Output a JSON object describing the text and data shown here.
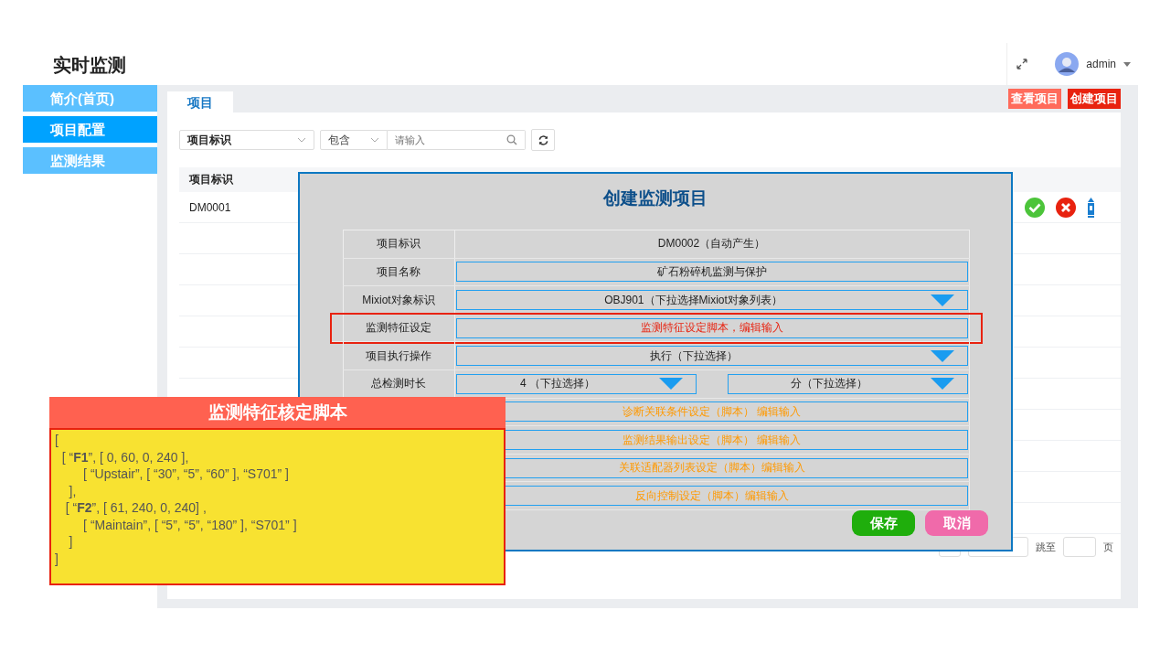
{
  "header": {
    "title": "实时监测",
    "user": "admin"
  },
  "sidebar": {
    "items": [
      {
        "label": "简介(首页)",
        "selected": false
      },
      {
        "label": "项目配置",
        "selected": true
      },
      {
        "label": "监测结果",
        "selected": false
      }
    ]
  },
  "tabs": [
    {
      "label": "项目",
      "selected": true
    }
  ],
  "actions": [
    "查看项目",
    "创建项目"
  ],
  "filter": {
    "field": "项目标识",
    "operator": "包含",
    "placeholder": "请输入"
  },
  "table": {
    "columns": [
      "项目标识"
    ],
    "rows": [
      [
        "DM0001"
      ]
    ]
  },
  "pagination": {
    "jump_label": "跳至",
    "page_unit": "页"
  },
  "dialog": {
    "title": "创建监测项目",
    "rows": [
      {
        "label": "项目标识",
        "kind": "static",
        "value": "DM0002（自动产生）",
        "highlighted": false
      },
      {
        "label": "项目名称",
        "kind": "input",
        "value": "矿石粉碎机监测与保护",
        "highlighted": false
      },
      {
        "label": "Mixiot对象标识",
        "kind": "select",
        "value": "OBJ901（下拉选择Mixiot对象列表）",
        "highlighted": false
      },
      {
        "label": "监测特征设定",
        "kind": "script",
        "value": "监测特征设定脚本，编辑输入",
        "highlighted": true
      },
      {
        "label": "项目执行操作",
        "kind": "select",
        "value": "执行（下拉选择）",
        "highlighted": false
      },
      {
        "label": "总检测时长",
        "kind": "select2",
        "values": [
          "4 （下拉选择）",
          "分（下拉选择）"
        ],
        "highlighted": false
      },
      {
        "kind": "script",
        "value": "诊断关联条件设定（脚本） 编辑输入",
        "highlighted": false
      },
      {
        "kind": "script",
        "value": "监测结果输出设定（脚本） 编辑输入",
        "highlighted": false
      },
      {
        "kind": "script",
        "value": "关联适配器列表设定（脚本）编辑输入",
        "highlighted": false
      },
      {
        "kind": "script",
        "value": "反向控制设定（脚本）编辑输入",
        "highlighted": false
      }
    ],
    "buttons": [
      "保存",
      "取消"
    ]
  },
  "script_panel": {
    "title": "监测特征核定脚本",
    "lines": [
      "[",
      "  [ “**F1**”, [ 0, 60, 0, 240 ],",
      "        [ “Upstair”, [ “30”, “5”, “60” ], “S701” ]",
      "    ],",
      "   [ “**F2**”, [ 61, 240, 0, 240] ,",
      "        [ “Maintain”, [ “5”, “5”, “180” ], “S701” ]",
      "    ]",
      "]"
    ]
  }
}
